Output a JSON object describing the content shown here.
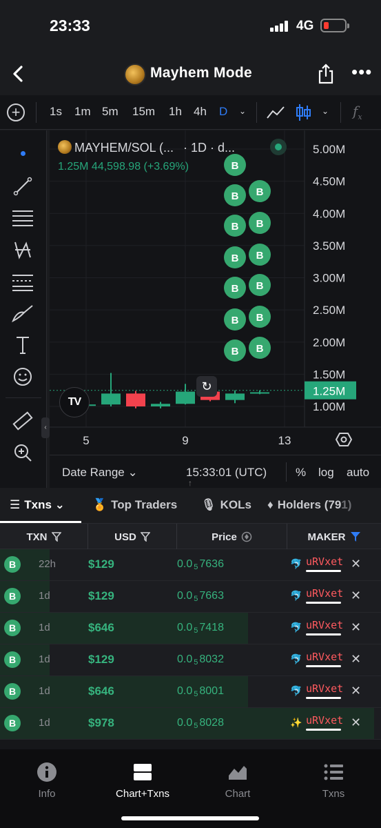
{
  "status_bar": {
    "time": "23:33",
    "network": "4G"
  },
  "header": {
    "title": "Mayhem Mode"
  },
  "toolbar": {
    "timeframes": [
      "1s",
      "1m",
      "5m",
      "15m",
      "1h",
      "4h",
      "D"
    ],
    "active_timeframe": "D",
    "fx_label": "f",
    "fx_sub": "x"
  },
  "chart": {
    "pair": "MAYHEM/SOL (...",
    "interval": "· 1D · d...",
    "ohlc_summary": "1.25M  44,598.98 (+3.69%)",
    "current_price_label": "1.25M",
    "marker_label": "B",
    "logo_text": "TV",
    "colors": {
      "up": "#26a67a",
      "down": "#f2424d",
      "marker": "#36a86f",
      "grid": "#1f2025"
    }
  },
  "chart_data": {
    "type": "candlestick",
    "y_ticks": [
      "5.00M",
      "4.50M",
      "4.00M",
      "3.50M",
      "3.00M",
      "2.50M",
      "2.00M",
      "1.50M",
      "1.00M"
    ],
    "x_ticks": [
      "5",
      "9",
      "13"
    ],
    "ylim": [
      0.75,
      5.1
    ],
    "candles": [
      {
        "open": 1.02,
        "high": 1.12,
        "low": 0.97,
        "close": 1.03
      },
      {
        "open": 1.03,
        "high": 1.52,
        "low": 1.0,
        "close": 1.2
      },
      {
        "open": 1.2,
        "high": 1.24,
        "low": 0.97,
        "close": 1.0
      },
      {
        "open": 1.0,
        "high": 1.07,
        "low": 0.97,
        "close": 1.04
      },
      {
        "open": 1.04,
        "high": 1.35,
        "low": 1.03,
        "close": 1.23
      },
      {
        "open": 1.23,
        "high": 1.27,
        "low": 1.08,
        "close": 1.1
      },
      {
        "open": 1.1,
        "high": 1.25,
        "low": 1.05,
        "close": 1.2
      },
      {
        "open": 1.21,
        "high": 1.25,
        "low": 1.19,
        "close": 1.22
      }
    ],
    "current_price": 1.25
  },
  "range_bar": {
    "date_range": "Date Range",
    "clock": "15:33:01 (UTC)",
    "options": [
      "%",
      "log",
      "auto"
    ]
  },
  "tabs": {
    "txns": "Txns",
    "top_traders": "Top Traders",
    "kols": "KOLs",
    "holders": "Holders (79",
    "holders_faded": "1)"
  },
  "columns": {
    "txn": "TXN",
    "usd": "USD",
    "price": "Price",
    "maker": "MAKER"
  },
  "rows": [
    {
      "type": "B",
      "age": "22h",
      "usd": "$129",
      "price_prefix": "0.0",
      "price_zeros": "5",
      "price_digits": "7636",
      "maker": "uRVxet"
    },
    {
      "type": "B",
      "age": "1d",
      "usd": "$129",
      "price_prefix": "0.0",
      "price_zeros": "5",
      "price_digits": "7663",
      "maker": "uRVxet"
    },
    {
      "type": "B",
      "age": "1d",
      "usd": "$646",
      "price_prefix": "0.0",
      "price_zeros": "5",
      "price_digits": "7418",
      "maker": "uRVxet"
    },
    {
      "type": "B",
      "age": "1d",
      "usd": "$129",
      "price_prefix": "0.0",
      "price_zeros": "5",
      "price_digits": "8032",
      "maker": "uRVxet"
    },
    {
      "type": "B",
      "age": "1d",
      "usd": "$646",
      "price_prefix": "0.0",
      "price_zeros": "5",
      "price_digits": "8001",
      "maker": "uRVxet"
    },
    {
      "type": "B",
      "age": "1d",
      "usd": "$978",
      "price_prefix": "0.0",
      "price_zeros": "5",
      "price_digits": "8028",
      "maker": "uRVxet"
    }
  ],
  "bottom_nav": {
    "items": [
      "Info",
      "Chart+Txns",
      "Chart",
      "Txns"
    ],
    "active": "Chart+Txns"
  }
}
